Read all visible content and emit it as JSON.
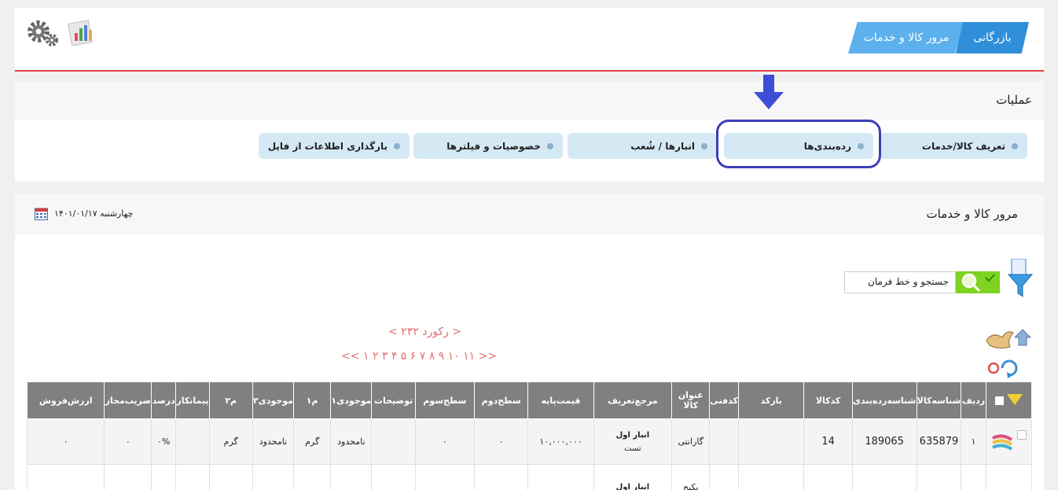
{
  "header": {
    "breadcrumb": [
      "بازرگانی",
      "مرور کالا و خدمات"
    ],
    "settings_icon": "gear-icon",
    "report_icon": "chart-report-icon"
  },
  "operations": {
    "title": "عملیات",
    "tabs": [
      {
        "label": "تعریف کالا/خدمات"
      },
      {
        "label": "رده‌بندی‌ها"
      },
      {
        "label": "انبارها / شُعب"
      },
      {
        "label": "خصوصیات و فیلترها"
      },
      {
        "label": "بارگذاری اطلاعات از فایل"
      }
    ],
    "highlight_color": "#3b3fb8",
    "arrow_color": "#3d4fd6"
  },
  "main": {
    "title": "مرور کالا و خدمات",
    "date": "چهارشنبه ۱۴۰۱/۰۱/۱۷",
    "search_text": "جستجو و خط فرمان",
    "records": "<   ۲۳۲ رکورد   >",
    "pager": "<<   ۱ ۲ ۳ ۴ ۵ ۶ ۷ ۸ ۹ ۱۰ ۱۱   >>"
  },
  "table": {
    "headers": [
      "ردیف",
      "شناسه‌کالا",
      "شناسه‌رده‌بندی",
      "کدکالا",
      "بارکد",
      "کدفنی",
      "عنوان کالا",
      "مرجع‌تعریف",
      "قیمت‌پایه",
      "سطح‌دوم",
      "سطح‌سوم",
      "توضیحات",
      "موجودی۱",
      "م۱",
      "موجودی۲",
      "م۲",
      "پیمانکار",
      "درصد",
      "ضریب‌مجاز",
      "ارزش‌فروش"
    ],
    "rows": [
      {
        "index": "۱",
        "product_id": "635879",
        "category_id": "189065",
        "code": "14",
        "barcode": "",
        "tech_code": "",
        "title": "گارانتی",
        "ref_main": "انبار اول",
        "ref_sub": "تست",
        "base_price": "۱۰,۰۰۰,۰۰۰",
        "level2": "۰",
        "level3": "۰",
        "desc": "",
        "stock1": "نامحدود",
        "unit1": "گرم",
        "stock2": "نامحدود",
        "unit2": "گرم",
        "contractor": "",
        "percent": "۰%",
        "coef": "۰",
        "sale_value": "۰"
      },
      {
        "index": "",
        "product_id": "",
        "category_id": "",
        "code": "",
        "barcode": "",
        "tech_code": "",
        "title": "پکیج",
        "ref_main": "انبار اول",
        "ref_sub": "",
        "base_price": "",
        "level2": "",
        "level3": "",
        "desc": "",
        "stock1": "",
        "unit1": "",
        "stock2": "",
        "unit2": "",
        "contractor": "",
        "percent": "",
        "coef": "",
        "sale_value": ""
      }
    ]
  }
}
